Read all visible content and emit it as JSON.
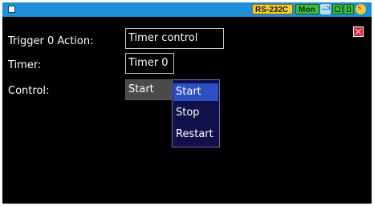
{
  "status_bar": {
    "interface_badge": "RS-232C",
    "monitor_badge": "Mon",
    "icons": [
      "window-icon",
      "usb-icon",
      "network-icon",
      "sdcard-icon",
      "power-icon"
    ],
    "colors": {
      "bar": "#1f8fd8",
      "interface": "#f4cc3a",
      "monitor": "#3ec03e"
    }
  },
  "form": {
    "trigger_action": {
      "label": "Trigger 0 Action:",
      "value": "Timer control"
    },
    "timer": {
      "label": "Timer:",
      "value": "Timer 0"
    },
    "control": {
      "label": "Control:",
      "value": "Start"
    }
  },
  "dropdown": {
    "options": [
      "Start",
      "Stop",
      "Restart"
    ],
    "highlighted": "Start",
    "colors": {
      "background": "#10104a",
      "highlight": "#2d4fc0"
    }
  },
  "close_icon": "close-icon"
}
